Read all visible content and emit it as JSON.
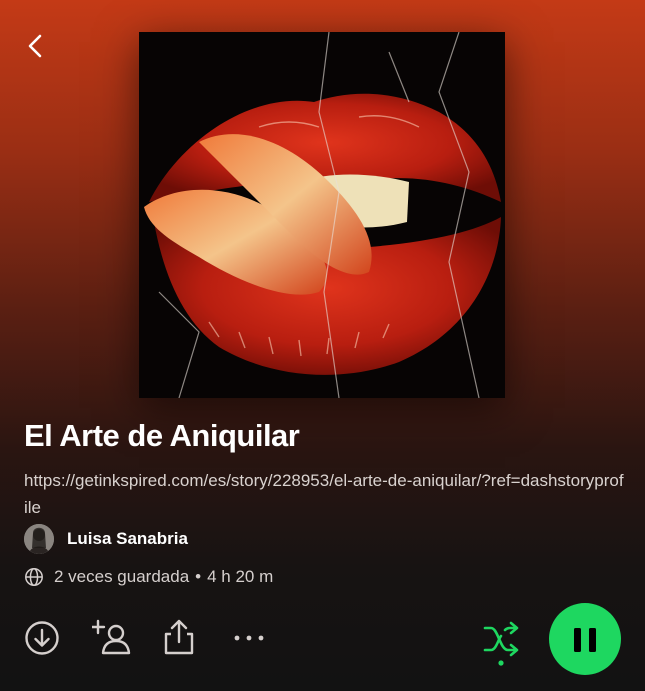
{
  "header": {
    "back_icon": "chevron-left-icon"
  },
  "playlist": {
    "title": "El Arte de Aniquilar",
    "description": "https://getinkspired.com/es/story/228953/el-arte-de-aniquilar/?ref=dashstoryprofile",
    "owner": {
      "name": "Luisa Sanabria"
    },
    "saves": "2 veces guardada",
    "separator": "•",
    "duration": "4 h 20 m"
  },
  "actions": {
    "download_icon": "download-icon",
    "add_user_icon": "add-user-icon",
    "share_icon": "share-icon",
    "more_icon": "more-options-icon",
    "shuffle_icon": "shuffle-icon",
    "play_pause_icon": "pause-icon"
  },
  "colors": {
    "accent": "#1ed760",
    "top_gradient": "#c43a16",
    "background": "#121212"
  }
}
